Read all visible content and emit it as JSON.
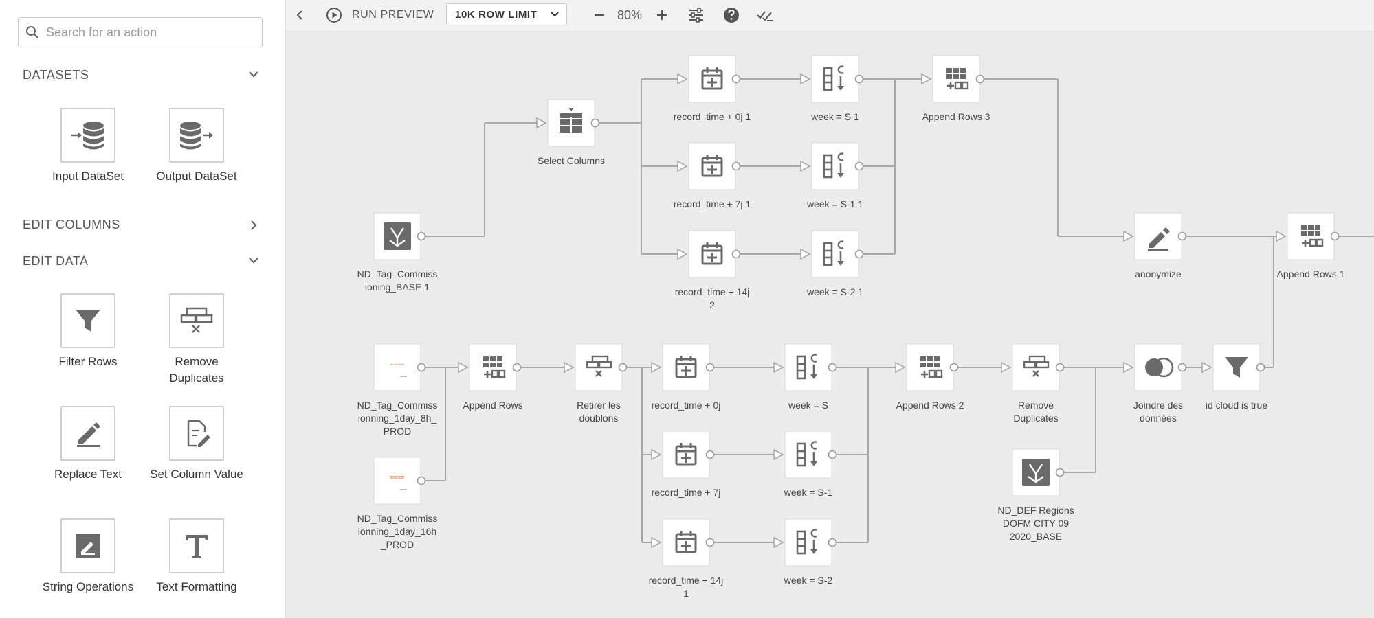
{
  "search": {
    "placeholder": "Search for an action"
  },
  "sidebar": {
    "datasets_header": "DATASETS",
    "edit_columns_header": "EDIT COLUMNS",
    "edit_data_header": "EDIT DATA",
    "datasets": [
      {
        "label": "Input DataSet",
        "icon": "input-dataset-icon"
      },
      {
        "label": "Output DataSet",
        "icon": "output-dataset-icon"
      }
    ],
    "edit_data": [
      {
        "label": "Filter Rows",
        "icon": "filter-icon"
      },
      {
        "label": "Remove Duplicates",
        "icon": "remove-duplicates-icon"
      },
      {
        "label": "Replace Text",
        "icon": "pencil-icon"
      },
      {
        "label": "Set Column Value",
        "icon": "edit-document-icon"
      },
      {
        "label": "String Operations",
        "icon": "string-operations-icon"
      },
      {
        "label": "Text Formatting",
        "icon": "text-format-icon"
      }
    ]
  },
  "toolbar": {
    "run_preview": "RUN PREVIEW",
    "row_limit": "10K ROW LIMIT",
    "zoom": "80%"
  },
  "colors": {
    "node_icon": "#6a6a6a",
    "connector": "#a8a8a8",
    "canvas_bg": "#ececec",
    "orange_source": "#e8884a"
  },
  "nodes": [
    {
      "id": "select_columns",
      "label": "Select Columns",
      "icon": "select-columns-icon"
    },
    {
      "id": "rt0j1",
      "label": "record_time + 0j 1",
      "icon": "calendar-plus-icon"
    },
    {
      "id": "rt7j1",
      "label": "record_time + 7j 1",
      "icon": "calendar-plus-icon"
    },
    {
      "id": "rt14j2",
      "label": "record_time + 14j\n2",
      "icon": "calendar-plus-icon"
    },
    {
      "id": "wS1",
      "label": "week = S 1",
      "icon": "column-sort-icon"
    },
    {
      "id": "wS11",
      "label": "week = S-1 1",
      "icon": "column-sort-icon"
    },
    {
      "id": "wS21",
      "label": "week = S-2 1",
      "icon": "column-sort-icon"
    },
    {
      "id": "append3",
      "label": "Append Rows 3",
      "icon": "append-rows-icon"
    },
    {
      "id": "base1",
      "label": "ND_Tag_Commiss\nioning_BASE 1",
      "icon": "dataset-merge-icon"
    },
    {
      "id": "anonymize",
      "label": "anonymize",
      "icon": "pencil-icon"
    },
    {
      "id": "append1",
      "label": "Append Rows 1",
      "icon": "append-rows-icon"
    },
    {
      "id": "prod8h",
      "label": "ND_Tag_Commiss\nionning_1day_8h_\nPROD",
      "icon": "data-source-thumbnail"
    },
    {
      "id": "prod16h",
      "label": "ND_Tag_Commiss\nionning_1day_16h\n_PROD",
      "icon": "data-source-thumbnail"
    },
    {
      "id": "append",
      "label": "Append Rows",
      "icon": "append-rows-icon"
    },
    {
      "id": "retirer",
      "label": "Retirer les\ndoublons",
      "icon": "remove-duplicates-icon"
    },
    {
      "id": "rt0j",
      "label": "record_time + 0j",
      "icon": "calendar-plus-icon"
    },
    {
      "id": "rt7j",
      "label": "record_time + 7j",
      "icon": "calendar-plus-icon"
    },
    {
      "id": "rt14j1",
      "label": "record_time + 14j\n1",
      "icon": "calendar-plus-icon"
    },
    {
      "id": "wS",
      "label": "week = S",
      "icon": "column-sort-icon"
    },
    {
      "id": "wSm1",
      "label": "week = S-1",
      "icon": "column-sort-icon"
    },
    {
      "id": "wSm2",
      "label": "week = S-2",
      "icon": "column-sort-icon"
    },
    {
      "id": "append2",
      "label": "Append Rows 2",
      "icon": "append-rows-icon"
    },
    {
      "id": "removedup",
      "label": "Remove\nDuplicates",
      "icon": "remove-duplicates-icon"
    },
    {
      "id": "regions",
      "label": "ND_DEF Regions\nDOFM CITY 09\n2020_BASE",
      "icon": "dataset-merge-icon"
    },
    {
      "id": "joindre",
      "label": "Joindre des\ndonnées",
      "icon": "join-icon"
    },
    {
      "id": "idcloud",
      "label": "id cloud is true",
      "icon": "filter-icon"
    }
  ],
  "edges": [
    [
      "base1",
      "select_columns"
    ],
    [
      "select_columns",
      "rt0j1"
    ],
    [
      "select_columns",
      "rt7j1"
    ],
    [
      "select_columns",
      "rt14j2"
    ],
    [
      "rt0j1",
      "wS1"
    ],
    [
      "rt7j1",
      "wS11"
    ],
    [
      "rt14j2",
      "wS21"
    ],
    [
      "wS1",
      "append3"
    ],
    [
      "wS11",
      "append3"
    ],
    [
      "wS21",
      "append3"
    ],
    [
      "append3",
      "anonymize"
    ],
    [
      "anonymize",
      "append1"
    ],
    [
      "prod8h",
      "append"
    ],
    [
      "prod16h",
      "append"
    ],
    [
      "append",
      "retirer"
    ],
    [
      "retirer",
      "rt0j"
    ],
    [
      "retirer",
      "rt7j"
    ],
    [
      "retirer",
      "rt14j1"
    ],
    [
      "rt0j",
      "wS"
    ],
    [
      "rt7j",
      "wSm1"
    ],
    [
      "rt14j1",
      "wSm2"
    ],
    [
      "wS",
      "append2"
    ],
    [
      "wSm1",
      "append2"
    ],
    [
      "wSm2",
      "append2"
    ],
    [
      "append2",
      "removedup"
    ],
    [
      "removedup",
      "joindre"
    ],
    [
      "regions",
      "joindre"
    ],
    [
      "joindre",
      "idcloud"
    ],
    [
      "idcloud",
      "append1"
    ],
    [
      "append1",
      "offscreen"
    ]
  ]
}
